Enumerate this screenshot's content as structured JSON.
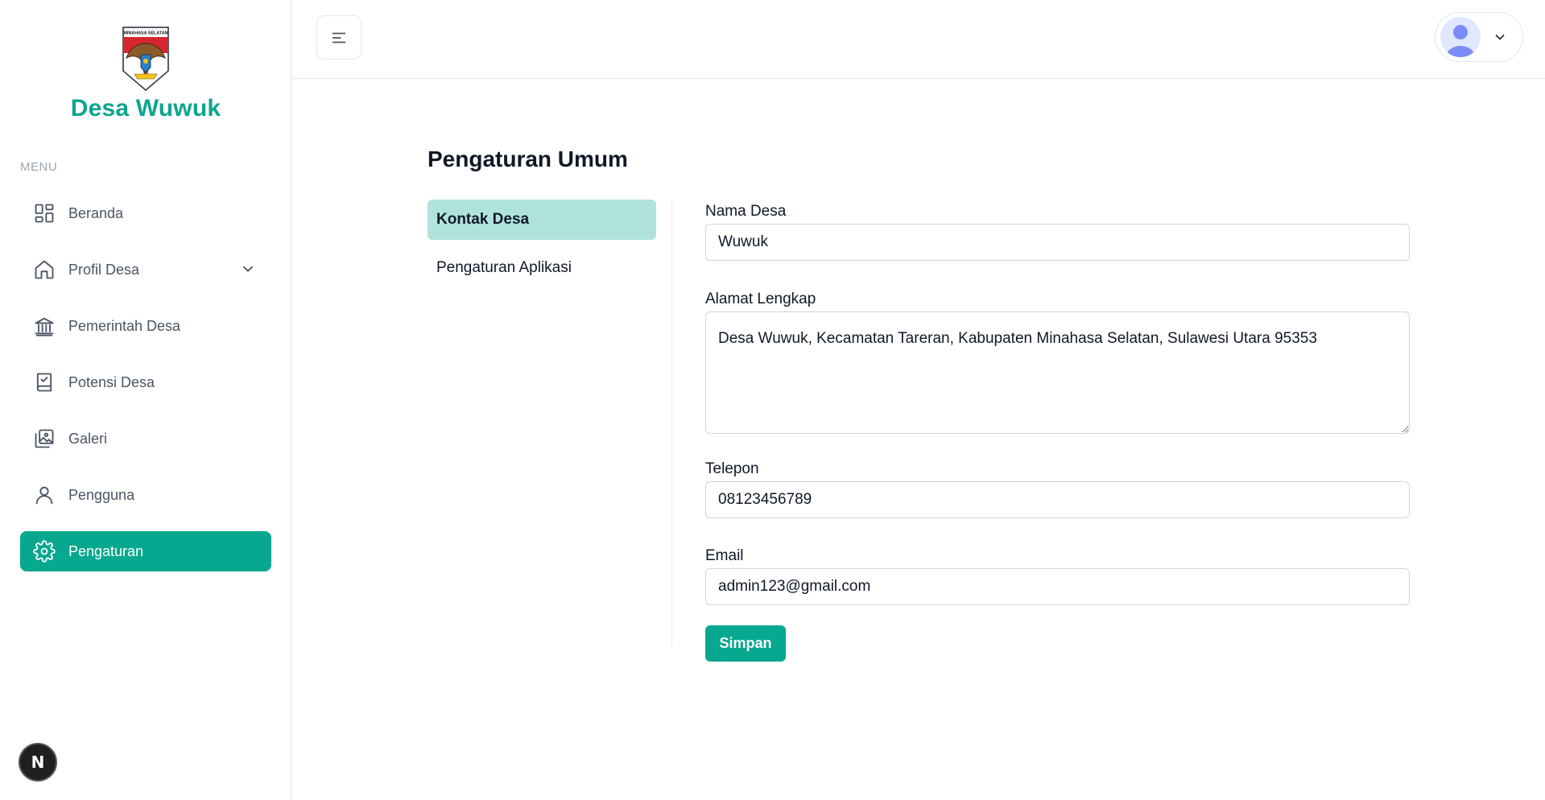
{
  "sidebar": {
    "logo_text": "MINAHASA SELATAN",
    "brand_name": "Desa Wuwuk",
    "menu_label": "MENU",
    "items": [
      {
        "label": "Beranda",
        "icon": "dashboard-icon"
      },
      {
        "label": "Profil Desa",
        "icon": "home-icon",
        "has_submenu": true
      },
      {
        "label": "Pemerintah Desa",
        "icon": "bank-icon"
      },
      {
        "label": "Potensi Desa",
        "icon": "book-check-icon"
      },
      {
        "label": "Galeri",
        "icon": "gallery-icon"
      },
      {
        "label": "Pengguna",
        "icon": "user-icon"
      },
      {
        "label": "Pengaturan",
        "icon": "gear-icon",
        "active": true
      }
    ],
    "framework_badge": "N"
  },
  "header": {
    "menu_toggle_icon": "hamburger-icon",
    "user_avatar_icon": "avatar-icon",
    "user_menu_icon": "chevron-down-icon"
  },
  "main": {
    "title": "Pengaturan Umum",
    "tabs": [
      {
        "label": "Kontak Desa",
        "active": true
      },
      {
        "label": "Pengaturan Aplikasi",
        "active": false
      }
    ],
    "form": {
      "nama_desa": {
        "label": "Nama Desa",
        "value": "Wuwuk"
      },
      "alamat": {
        "label": "Alamat Lengkap",
        "value": "Desa Wuwuk, Kecamatan Tareran, Kabupaten Minahasa Selatan, Sulawesi Utara 95353"
      },
      "telepon": {
        "label": "Telepon",
        "value": "08123456789"
      },
      "email": {
        "label": "Email",
        "value": "admin123@gmail.com"
      },
      "submit_label": "Simpan"
    }
  },
  "colors": {
    "accent": "#07a88f",
    "brand_text": "#0ea58f",
    "active_tab": "#b1e3dd"
  }
}
